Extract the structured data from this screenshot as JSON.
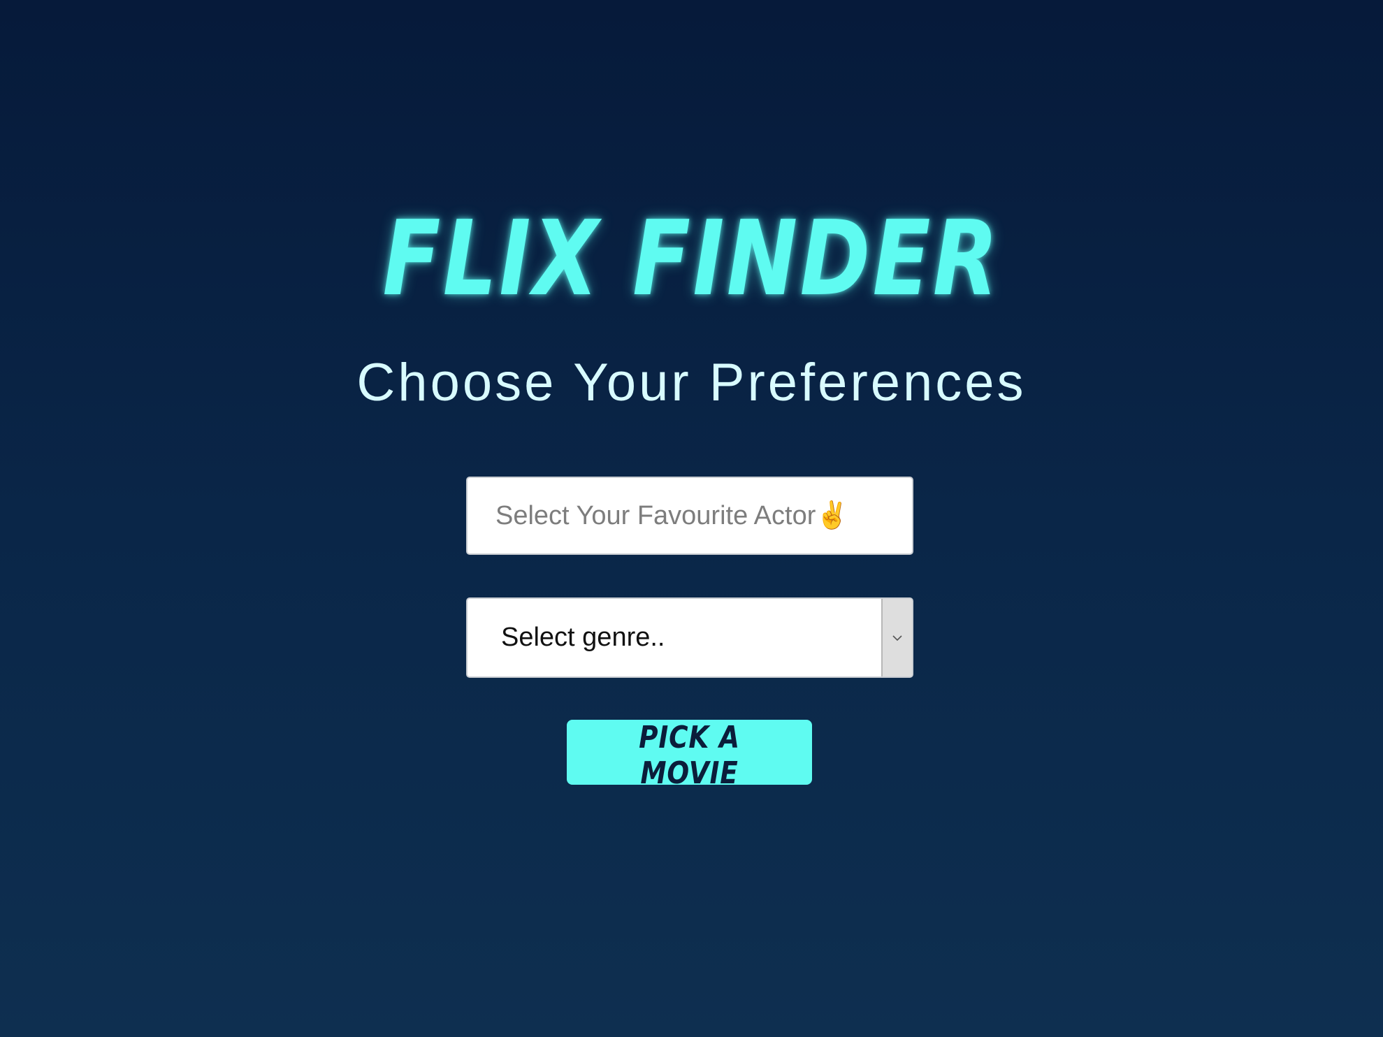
{
  "header": {
    "title": "FLIX FINDER",
    "subtitle": "Choose Your Preferences"
  },
  "form": {
    "actor_input": {
      "value": "",
      "placeholder": "Select Your Favourite Actor✌️"
    },
    "genre_select": {
      "selected": "Select genre..",
      "arrow_icon": "chevron-down-icon"
    },
    "submit_label": "PICK A MOVIE"
  },
  "colors": {
    "background_top": "#061a3a",
    "background_bottom": "#0e2f50",
    "accent": "#5ffbf1",
    "subtitle_text": "#d8fbff",
    "button_text": "#0b1d3a"
  }
}
